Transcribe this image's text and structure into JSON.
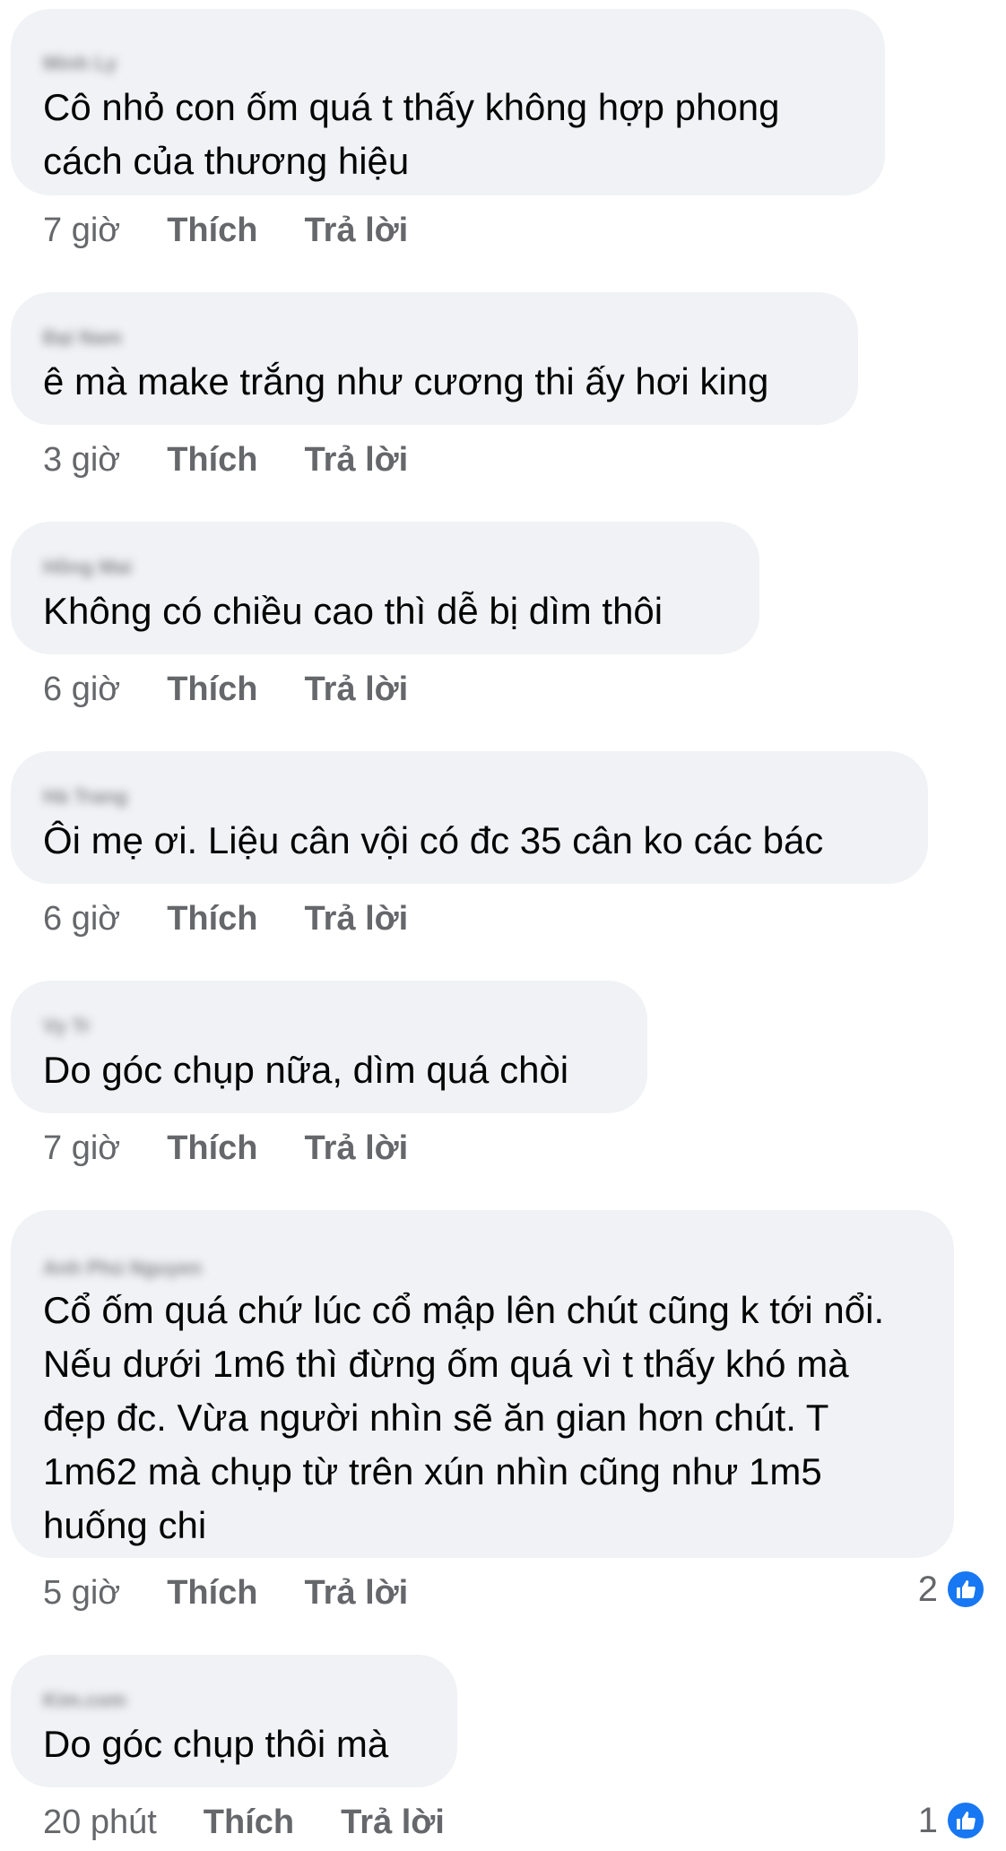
{
  "comments": [
    {
      "author": "Minh Ly",
      "text": "Cô nhỏ con ốm quá t thấy không hợp phong cách của thương hiệu",
      "time": "7 giờ",
      "like_label": "Thích",
      "reply_label": "Trả lời"
    },
    {
      "author": "Đại Nam",
      "text": "ê mà make trắng như cương thi ấy hơi king",
      "time": "3 giờ",
      "like_label": "Thích",
      "reply_label": "Trả lời"
    },
    {
      "author": "Hồng Mai",
      "text": "Không có chiều cao thì dễ bị dìm thôi",
      "time": "6 giờ",
      "like_label": "Thích",
      "reply_label": "Trả lời"
    },
    {
      "author": "Hà Trang",
      "text": "Ôi mẹ ơi. Liệu cân vội có đc 35 cân ko các bác",
      "time": "6 giờ",
      "like_label": "Thích",
      "reply_label": "Trả lời"
    },
    {
      "author": "Vy Tr",
      "text": "Do góc chụp nữa, dìm quá chòi",
      "time": "7 giờ",
      "like_label": "Thích",
      "reply_label": "Trả lời"
    },
    {
      "author": "Anh Phú Nguyen",
      "text": "Cổ ốm quá chứ lúc cổ mập lên chút cũng k tới nổi. Nếu dưới 1m6 thì đừng ốm quá vì t thấy khó mà đẹp đc. Vừa người nhìn sẽ ăn gian hơn chút. T 1m62 mà chụp từ trên xún nhìn cũng như 1m5 huống chi",
      "time": "5 giờ",
      "like_label": "Thích",
      "reply_label": "Trả lời",
      "reaction_count": "2"
    },
    {
      "author": "Kim.com",
      "text": "Do góc chụp thôi mà",
      "time": "20 phút",
      "like_label": "Thích",
      "reply_label": "Trả lời",
      "reaction_count": "1"
    }
  ],
  "icons": {
    "reaction": "like-thumbs-up-icon"
  },
  "colors": {
    "bubble": "#f0f2f5",
    "meta_text": "#65676b",
    "like_blue": "#1877f2"
  }
}
